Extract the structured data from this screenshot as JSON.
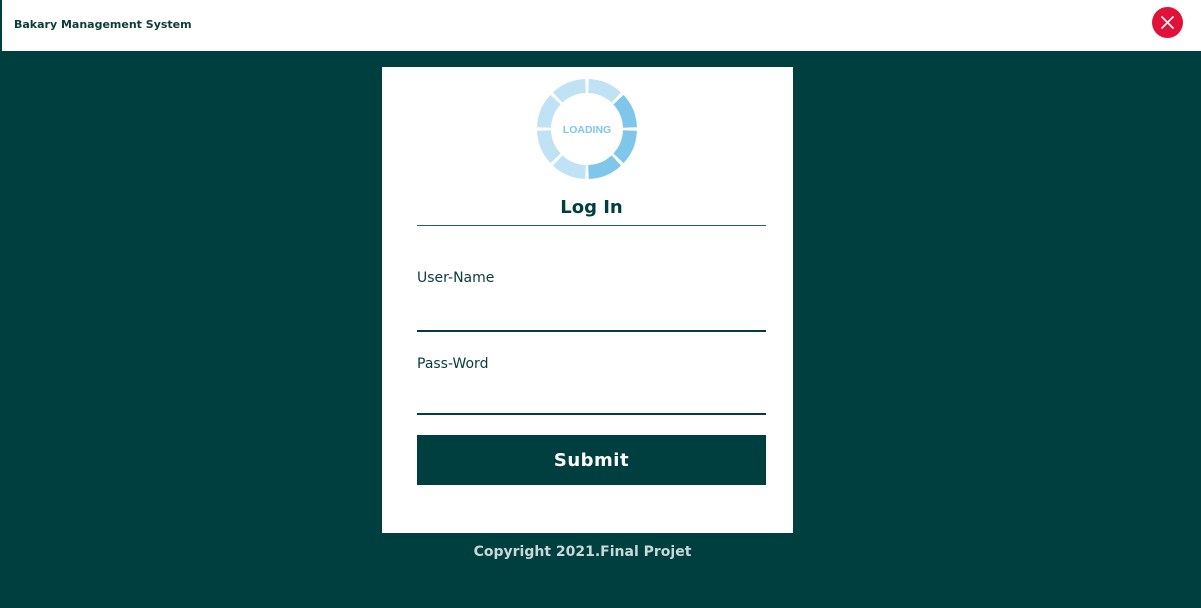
{
  "window": {
    "title": "Bakary Management System",
    "close_icon": "close-icon",
    "close_color": "#e0123a"
  },
  "login": {
    "loader_text": "LOADING",
    "title": "Log In",
    "username_label": "User-Name",
    "username_value": "",
    "password_label": "Pass-Word",
    "password_value": "",
    "submit_label": "Submit"
  },
  "footer": {
    "copyright": "Copyright 2021.Final Projet"
  },
  "colors": {
    "background": "#003f3f",
    "card": "#ffffff",
    "loader_light": "#bfe3f4",
    "loader_accent": "#7ec6ea"
  }
}
